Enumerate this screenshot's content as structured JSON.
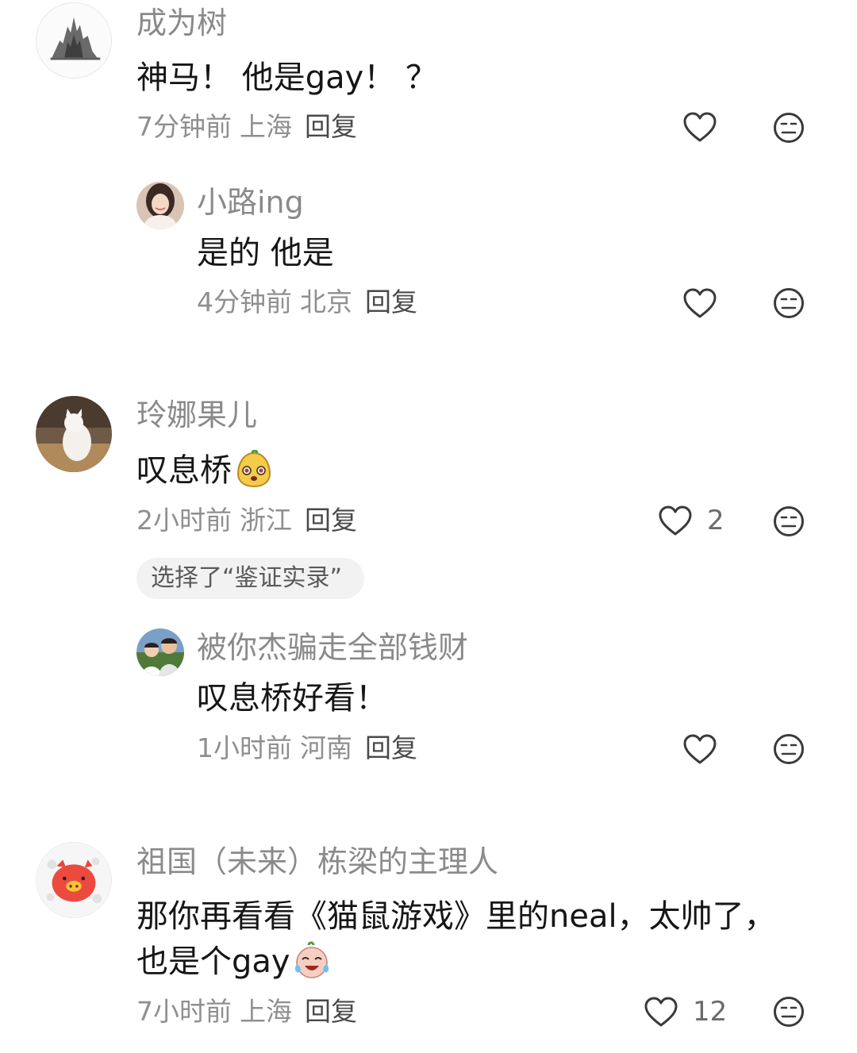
{
  "comments": [
    {
      "name": "成为树",
      "text": "神马！ 他是gay！ ？",
      "time": "7分钟前",
      "location": "上海",
      "reply_label": "回复",
      "avatar": "ink-tree-avatar"
    },
    {
      "name": "小路ing",
      "text": "是的 他是",
      "time": "4分钟前",
      "location": "北京",
      "reply_label": "回复",
      "avatar": "woman-portrait-avatar"
    },
    {
      "name": "玲娜果儿",
      "text": "叹息桥",
      "emoji": "yellow-face-emoji",
      "time": "2小时前",
      "location": "浙江",
      "reply_label": "回复",
      "likes": "2",
      "chip": "选择了“鉴证实录”",
      "avatar": "white-cat-avatar"
    },
    {
      "name": "被你杰骗走全部钱财",
      "text": "叹息桥好看！",
      "time": "1小时前",
      "location": "河南",
      "reply_label": "回复",
      "avatar": "two-people-avatar"
    },
    {
      "name": "祖国（未来）栋梁的主理人",
      "text_line1": "那你再看看《猫鼠游戏》里的neal，太帅了，",
      "text_line2": "也是个gay",
      "emoji": "crying-laugh-emoji",
      "time": "7小时前",
      "location": "上海",
      "reply_label": "回复",
      "likes": "12",
      "avatar": "red-pig-avatar"
    }
  ],
  "icons": {
    "like": "heart-outline-icon",
    "dislike": "meh-face-icon"
  },
  "colors": {
    "name": "#8a8a8a",
    "meta": "#8f8f8f",
    "text": "#161616",
    "icon": "#3a3a3a",
    "chip_bg": "#f2f2f2"
  }
}
